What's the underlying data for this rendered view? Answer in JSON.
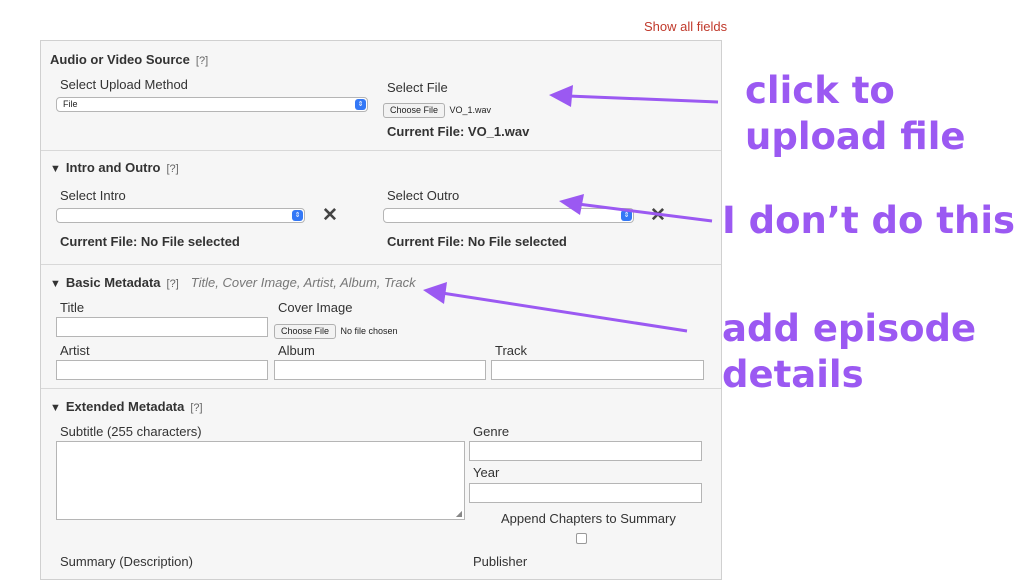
{
  "show_all_fields": "Show all fields",
  "sections": {
    "source": {
      "title": "Audio or Video Source",
      "help": "[?]",
      "upload_method_label": "Select Upload Method",
      "upload_method_value": "File",
      "select_file_label": "Select File",
      "choose_file_button": "Choose File",
      "chosen_file_name": "VO_1.wav",
      "current_file": "Current File: VO_1.wav"
    },
    "intro_outro": {
      "toggle": "▼",
      "title": "Intro and Outro",
      "help": "[?]",
      "intro_label": "Select Intro",
      "outro_label": "Select Outro",
      "intro_current": "Current File: No File selected",
      "outro_current": "Current File: No File selected",
      "clear_symbol": "✕"
    },
    "basic_metadata": {
      "toggle": "▼",
      "title": "Basic Metadata",
      "help": "[?]",
      "hint": "Title, Cover Image, Artist, Album, Track",
      "title_label": "Title",
      "cover_label": "Cover Image",
      "cover_button": "Choose File",
      "cover_status": "No file chosen",
      "artist_label": "Artist",
      "album_label": "Album",
      "track_label": "Track"
    },
    "extended_metadata": {
      "toggle": "▼",
      "title": "Extended Metadata",
      "help": "[?]",
      "subtitle_label": "Subtitle (255 characters)",
      "genre_label": "Genre",
      "year_label": "Year",
      "append_label": "Append Chapters to Summary",
      "append_checked": false,
      "summary_label": "Summary (Description)",
      "publisher_label": "Publisher"
    }
  },
  "annotations": {
    "upload": [
      "click to",
      "upload file"
    ],
    "intro": "I don’t do this",
    "details": [
      "add episode",
      "details"
    ],
    "color": "#9b59f2"
  },
  "colors": {
    "link": "#c0392b",
    "panel_bg": "#f6f6f6",
    "select_accent": "#3478f6"
  }
}
